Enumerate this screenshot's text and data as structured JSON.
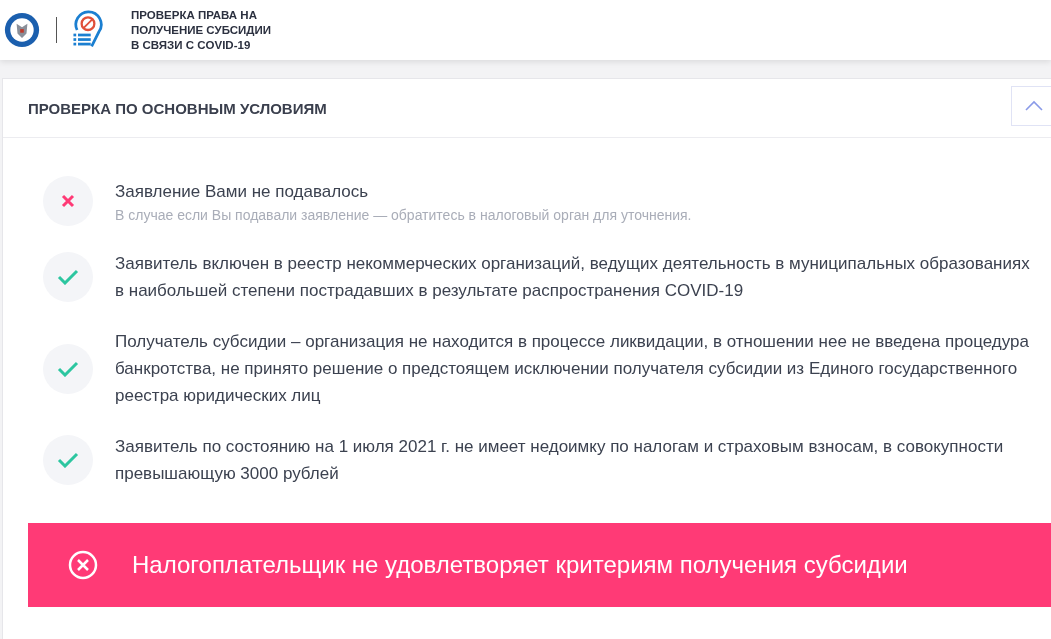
{
  "header": {
    "title_lines": [
      "ПРОВЕРКА ПРАВА НА",
      "ПОЛУЧЕНИЕ СУБСИДИИ",
      "В СВЯЗИ С COVID-19"
    ]
  },
  "section": {
    "title": "ПРОВЕРКА ПО ОСНОВНЫМ УСЛОВИЯМ",
    "expanded": true,
    "conditions": [
      {
        "passed": false,
        "text": "Заявление Вами не подавалось",
        "note": "В случае если Вы подавали заявление — обратитесь в налоговый орган для уточнения."
      },
      {
        "passed": true,
        "text": "Заявитель включен в реестр некоммерческих организаций, ведущих деятельность в муниципальных образованиях в наибольшей степени пострадавших в результате распространения COVID-19"
      },
      {
        "passed": true,
        "text": "Получатель субсидии – организация не находится в процессе ликвидации, в отношении нее не введена процедура банкротства, не принято решение о предстоящем исключении получателя субсидии из Единого государственного реестра юридических лиц"
      },
      {
        "passed": true,
        "text": "Заявитель по состоянию на 1 июля 2021 г. не имеет недоимку по налогам и страховым взносам, в совокупности превышающую 3000 рублей"
      }
    ]
  },
  "result": {
    "passed": false,
    "text": "Налогоплательщик не удовлетворяет критериям получения субсидии"
  }
}
